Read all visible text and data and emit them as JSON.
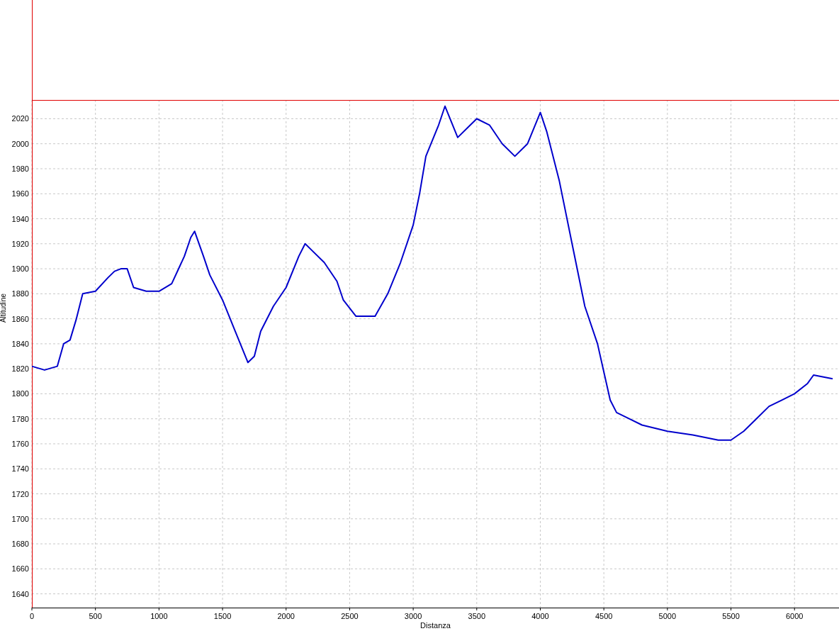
{
  "chart_data": {
    "type": "line",
    "grid": true,
    "xlabel": "Distanza",
    "ylabel": "Altitudine",
    "x": [
      0,
      100,
      200,
      250,
      300,
      350,
      400,
      500,
      600,
      650,
      700,
      750,
      800,
      900,
      1000,
      1100,
      1200,
      1250,
      1280,
      1350,
      1400,
      1500,
      1600,
      1700,
      1750,
      1800,
      1900,
      2000,
      2100,
      2150,
      2200,
      2300,
      2400,
      2450,
      2550,
      2700,
      2800,
      2900,
      3000,
      3050,
      3100,
      3200,
      3250,
      3350,
      3450,
      3500,
      3600,
      3700,
      3800,
      3900,
      4000,
      4050,
      4150,
      4250,
      4350,
      4450,
      4550,
      4600,
      4700,
      4800,
      5000,
      5200,
      5400,
      5500,
      5600,
      5700,
      5800,
      5900,
      6000,
      6100,
      6150,
      6300
    ],
    "series": [
      {
        "color": "#0000cc",
        "values": [
          1822,
          1819,
          1822,
          1840,
          1843,
          1860,
          1880,
          1882,
          1893,
          1898,
          1900,
          1900,
          1885,
          1882,
          1882,
          1888,
          1910,
          1925,
          1930,
          1910,
          1895,
          1875,
          1850,
          1825,
          1830,
          1850,
          1870,
          1885,
          1910,
          1920,
          1915,
          1905,
          1890,
          1875,
          1862,
          1862,
          1880,
          1905,
          1935,
          1960,
          1990,
          2015,
          2030,
          2005,
          2015,
          2020,
          2015,
          2000,
          1990,
          2000,
          2025,
          2010,
          1970,
          1920,
          1870,
          1840,
          1795,
          1785,
          1780,
          1775,
          1770,
          1767,
          1763,
          1763,
          1770,
          1780,
          1790,
          1795,
          1800,
          1808,
          1815,
          1812
        ]
      }
    ],
    "xlim": [
      0,
      6350
    ],
    "ylim": [
      1629,
      2035
    ],
    "xticks": [
      0,
      500,
      1000,
      1500,
      2000,
      2500,
      3000,
      3500,
      4000,
      4500,
      5000,
      5500,
      6000
    ],
    "yticks": [
      1640,
      1660,
      1680,
      1700,
      1720,
      1740,
      1760,
      1780,
      1800,
      1820,
      1840,
      1860,
      1880,
      1900,
      1920,
      1940,
      1960,
      1980,
      2000,
      2020
    ]
  }
}
